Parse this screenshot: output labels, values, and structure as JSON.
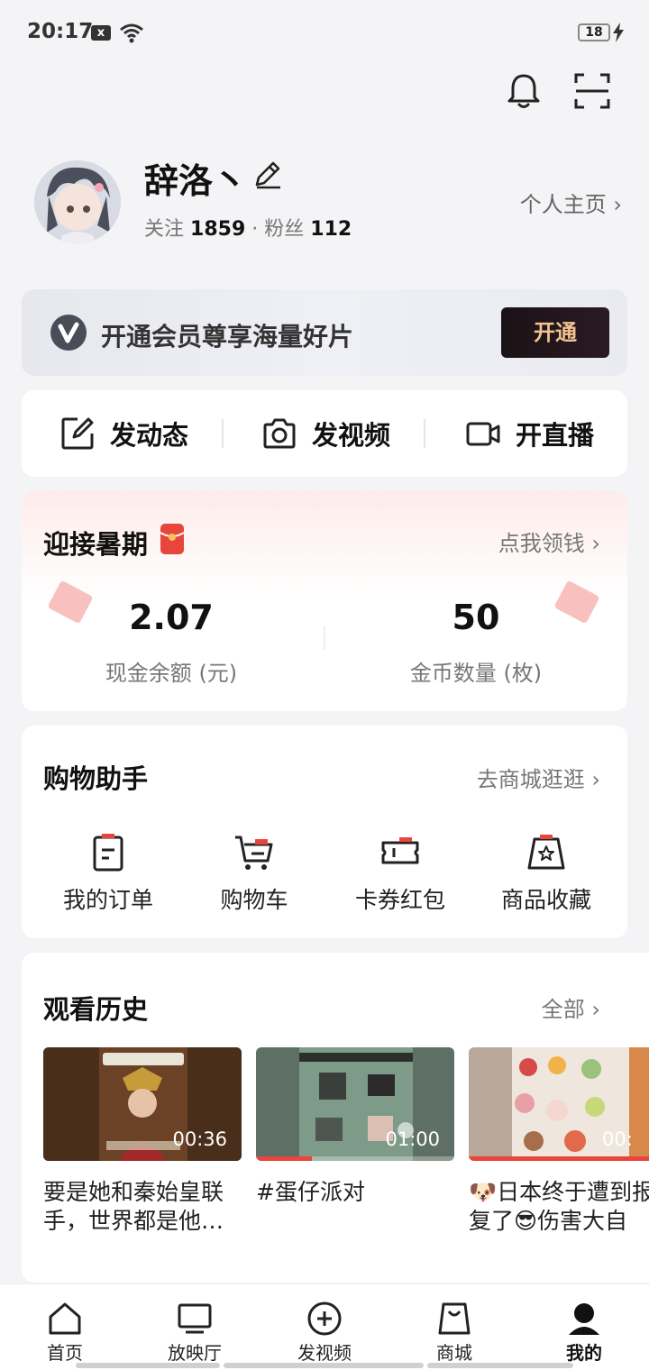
{
  "status_bar": {
    "time": "20:17",
    "notification_badge": "x",
    "battery": "18"
  },
  "header": {
    "bell_icon": "bell-icon",
    "scan_icon": "scan-icon"
  },
  "profile": {
    "username": "辞洛丶",
    "following_label": "关注",
    "following_count": "1859",
    "separator": "·",
    "fans_label": "粉丝",
    "fans_count": "112",
    "home_link": "个人主页 ›"
  },
  "vip": {
    "logo_letter": "v",
    "text": "开通会员尊享海量好片",
    "button": "开通"
  },
  "actions": [
    {
      "icon": "edit-post-icon",
      "label": "发动态"
    },
    {
      "icon": "camera-icon",
      "label": "发视频"
    },
    {
      "icon": "video-camera-icon",
      "label": "开直播"
    }
  ],
  "summer": {
    "title": "迎接暑期",
    "link": "点我领钱 ›",
    "cash_value": "2.07",
    "cash_label": "现金余额 (元)",
    "coin_value": "50",
    "coin_label": "金币数量 (枚)"
  },
  "shopping": {
    "title": "购物助手",
    "link": "去商城逛逛 ›",
    "items": [
      {
        "icon": "order-icon",
        "label": "我的订单"
      },
      {
        "icon": "cart-icon",
        "label": "购物车"
      },
      {
        "icon": "coupon-icon",
        "label": "卡券红包"
      },
      {
        "icon": "favorite-bag-icon",
        "label": "商品收藏"
      }
    ]
  },
  "history": {
    "title": "观看历史",
    "link": "全部 ›",
    "items": [
      {
        "duration": "00:36",
        "caption": "要是她和秦始皇联手，世界都是他…",
        "progress": 0.0
      },
      {
        "duration": "01:00",
        "caption": "#蛋仔派对",
        "progress": 0.28
      },
      {
        "duration": "00:",
        "caption": "🐶日本终于遭到报复了😎伤害大自",
        "progress": 1.0
      }
    ]
  },
  "nav": [
    {
      "icon": "home-icon",
      "label": "首页"
    },
    {
      "icon": "tv-icon",
      "label": "放映厅"
    },
    {
      "icon": "add-circle-icon",
      "label": "发视频"
    },
    {
      "icon": "shopping-bag-icon",
      "label": "商城"
    },
    {
      "icon": "person-icon",
      "label": "我的"
    }
  ],
  "colors": {
    "accent_red": "#e8453c",
    "vip_gold": "#f1c38f",
    "vip_dark": "#1a1216"
  }
}
